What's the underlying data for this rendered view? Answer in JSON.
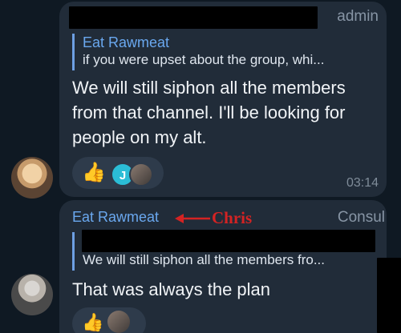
{
  "messages": [
    {
      "role_badge": "admin",
      "reply": {
        "name": "Eat Rawmeat",
        "text": "if you were upset about the group, whi..."
      },
      "text": "We will still siphon all the members from that channel. I'll be looking for people on my alt.",
      "reactions": {
        "emoji": "👍",
        "avatar_initial": "J"
      },
      "time": "03:14"
    },
    {
      "sender": "Eat Rawmeat",
      "role_badge": "Consul",
      "annotation": {
        "arrow": "⟵",
        "label": "Chris"
      },
      "reply": {
        "text": "We will still siphon all the members fro..."
      },
      "text": "That was always the plan",
      "reactions": {
        "emoji": "👍"
      }
    }
  ],
  "colors": {
    "background": "#0f1923",
    "bubble": "#212c39",
    "accent": "#6aa8ef",
    "annotation": "#d42323"
  },
  "icons": [
    "thumbs-up-icon",
    "user-avatar-icon"
  ]
}
